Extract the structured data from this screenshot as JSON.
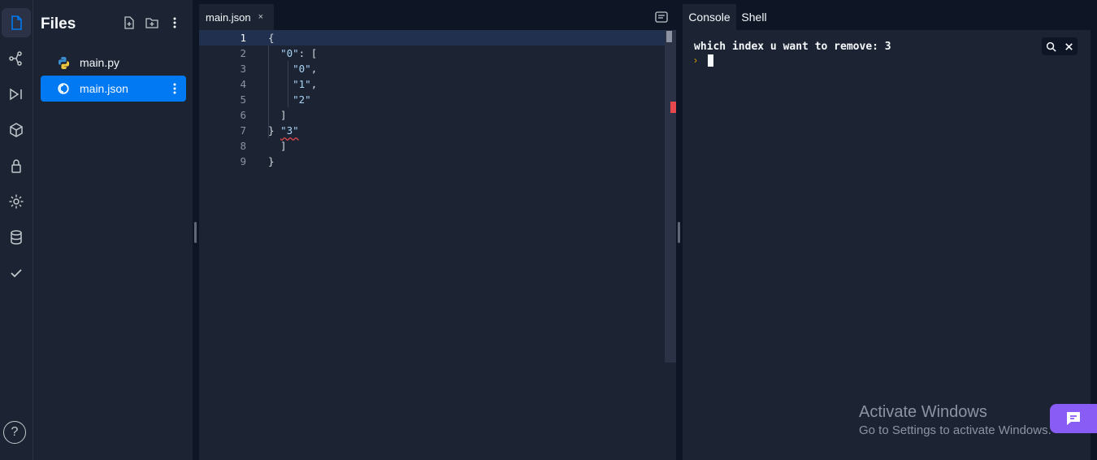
{
  "activity_bar": {
    "items": [
      "files",
      "git",
      "run",
      "packages",
      "secrets",
      "settings",
      "database",
      "check"
    ],
    "help_label": "?"
  },
  "files_panel": {
    "title": "Files",
    "files": [
      {
        "name": "main.py",
        "icon": "python-icon",
        "active": false
      },
      {
        "name": "main.json",
        "icon": "json-icon",
        "active": true
      }
    ]
  },
  "editor": {
    "tab": {
      "label": "main.json",
      "close": "×"
    },
    "line_numbers": [
      "1",
      "2",
      "3",
      "4",
      "5",
      "6",
      "7",
      "8",
      "9"
    ],
    "current_line": "1"
  },
  "console": {
    "tabs": [
      {
        "label": "Console",
        "active": true
      },
      {
        "label": "Shell",
        "active": false
      }
    ],
    "output": "which index u want to remove: 3",
    "prompt": "›"
  },
  "watermark": {
    "title": "Activate Windows",
    "subtitle": "Go to Settings to activate Windows."
  },
  "colors": {
    "accent": "#0079f2",
    "background": "#0e1525",
    "panel": "#1c2333",
    "error": "#e5484d",
    "chat": "#8a5cf6"
  }
}
